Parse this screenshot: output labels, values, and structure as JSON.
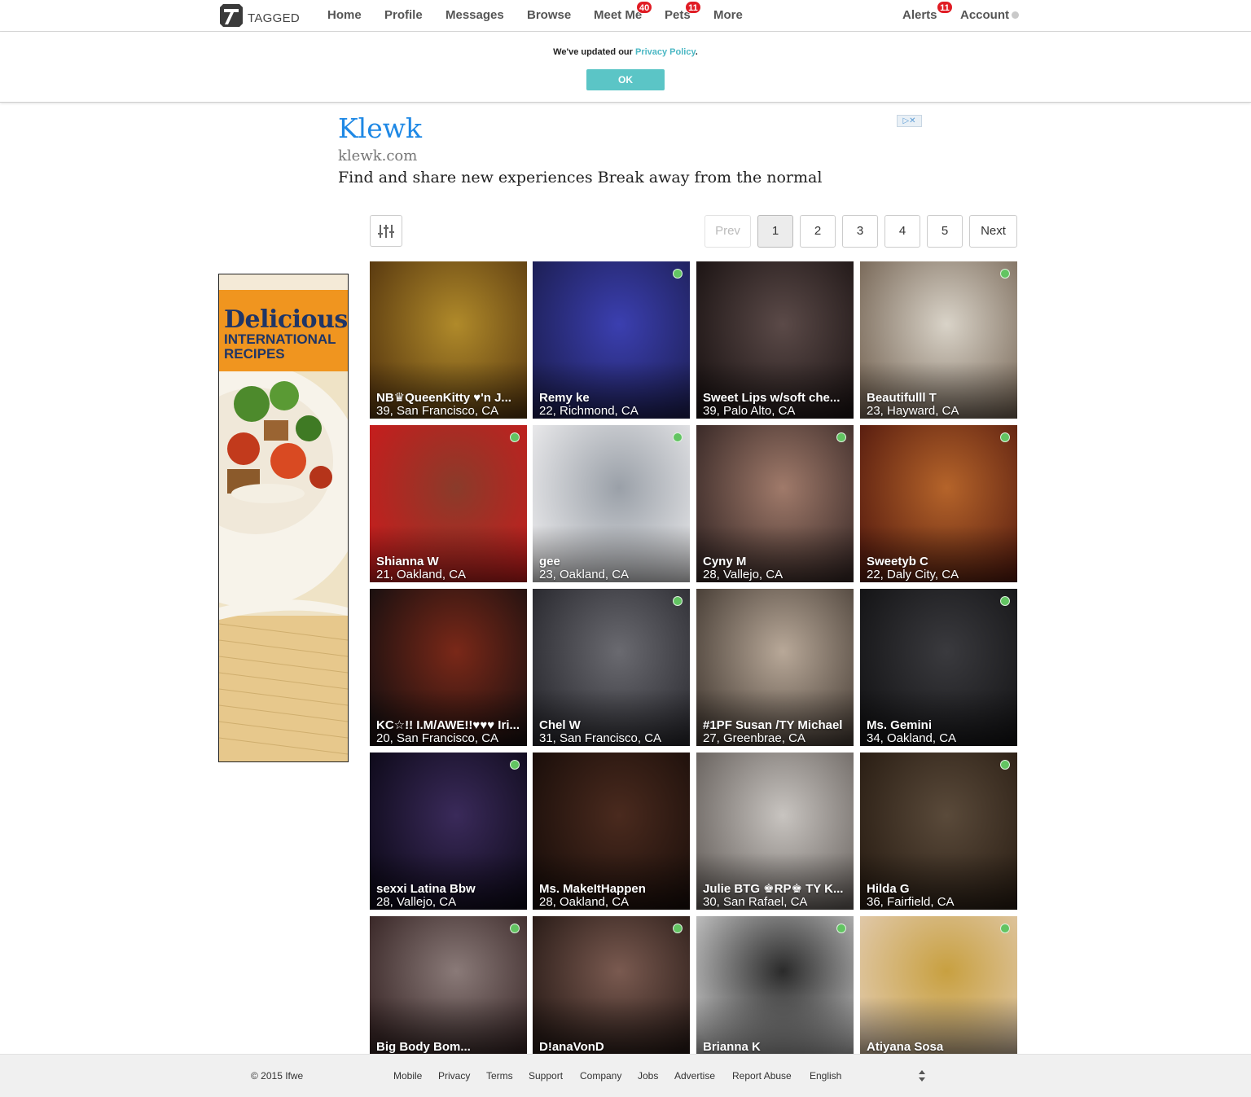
{
  "brand": {
    "logo_text": "TAGGED"
  },
  "nav": {
    "home": "Home",
    "profile": "Profile",
    "messages": "Messages",
    "browse": "Browse",
    "meetme": "Meet Me",
    "meetme_badge": "40",
    "pets": "Pets",
    "pets_badge": "11",
    "more": "More",
    "alerts": "Alerts",
    "alerts_badge": "11",
    "account": "Account"
  },
  "notice": {
    "text_before": "We've updated our ",
    "link": "Privacy Policy",
    "text_after": ".",
    "ok_label": "OK"
  },
  "ad": {
    "title": "Klewk",
    "url": "klewk.com",
    "description": "Find and share new experiences Break away from the normal"
  },
  "side_ad": {
    "headline": "Delicious",
    "line2": "INTERNATIONAL",
    "line3": "RECIPES"
  },
  "pagination": {
    "prev": "Prev",
    "pages": [
      "1",
      "2",
      "3",
      "4",
      "5"
    ],
    "current": "1",
    "next": "Next"
  },
  "profiles": [
    {
      "name": "NB♛QueenKitty ♥'n J...",
      "info": "39, San Francisco, CA",
      "online": false
    },
    {
      "name": "Remy ke",
      "info": "22, Richmond, CA",
      "online": true
    },
    {
      "name": "Sweet Lips w/soft che...",
      "info": "39, Palo Alto, CA",
      "online": false
    },
    {
      "name": "Beautifulll T",
      "info": "23, Hayward, CA",
      "online": true
    },
    {
      "name": "Shianna W",
      "info": "21, Oakland, CA",
      "online": true
    },
    {
      "name": "gee",
      "info": "23, Oakland, CA",
      "online": true
    },
    {
      "name": "Cyny M",
      "info": "28, Vallejo, CA",
      "online": true
    },
    {
      "name": "Sweetyb C",
      "info": "22, Daly City, CA",
      "online": true
    },
    {
      "name": "KC☆!! I.M/AWE!!♥♥♥ Iri...",
      "info": "20, San Francisco, CA",
      "online": false
    },
    {
      "name": "Chel W",
      "info": "31, San Francisco, CA",
      "online": true
    },
    {
      "name": "#1PF Susan /TY Michael",
      "info": "27, Greenbrae, CA",
      "online": false
    },
    {
      "name": "Ms. Gemini",
      "info": "34, Oakland, CA",
      "online": true
    },
    {
      "name": "sexxi Latina Bbw",
      "info": "28, Vallejo, CA",
      "online": true
    },
    {
      "name": "Ms. MakeItHappen",
      "info": "28, Oakland, CA",
      "online": false
    },
    {
      "name": "Julie BTG ♚RP♚ TY K...",
      "info": "30, San Rafael, CA",
      "online": false
    },
    {
      "name": "Hilda G",
      "info": "36, Fairfield, CA",
      "online": true
    },
    {
      "name": "Big Body Bom...",
      "info": "",
      "online": true
    },
    {
      "name": "D!anaVonD",
      "info": "",
      "online": true
    },
    {
      "name": "Brianna K",
      "info": "",
      "online": true
    },
    {
      "name": "Atiyana Sosa",
      "info": "",
      "online": true
    }
  ],
  "colors": {
    "accent": "#5bc5c6",
    "badge": "#e01c24",
    "online": "#62c462",
    "link": "#4cb8c4"
  },
  "footer": {
    "copyright": "© 2015 Ifwe",
    "links": [
      "Mobile",
      "Privacy",
      "Terms",
      "Support",
      "Company",
      "Jobs",
      "Advertise",
      "Report Abuse"
    ],
    "language": "English"
  }
}
